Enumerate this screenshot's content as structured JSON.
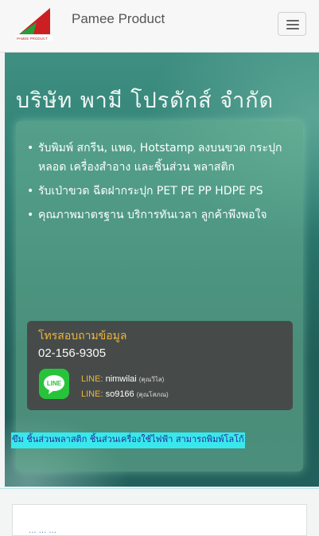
{
  "navbar": {
    "brand": "Pamee Product",
    "logo_text": "PAMEE PRODUCT"
  },
  "hero": {
    "title": "บริษัท พามี โปรดักส์ จำกัด",
    "features": [
      "รับพิมพ์ สกรีน, แพด, Hotstamp ลงบนขวด กระปุก หลอด เครื่องสำอาง และชิ้นส่วน พลาสติก",
      "รับเป่าขวด ฉีดฝากระปุก PET PE PP HDPE PS",
      "คุณภาพมาตรฐาน บริการทันเวลา ลูกค้าพึงพอใจ"
    ],
    "contact": {
      "label": "โทรสอบถามข้อมูล",
      "phone": "02-156-9305",
      "line_icon_text": "LINE",
      "line_entries": [
        {
          "label": "LINE:",
          "id": "nimwilai",
          "note": "(คุณวิไล)"
        },
        {
          "label": "LINE:",
          "id": "so9166",
          "note": "(คุณโสภณ)"
        }
      ]
    },
    "marquee": "ขึม ชิ้นส่วนพลาสติก ชิ้นส่วนเครื่องใช้ไฟฟ้า สามารถพิมพ์โลโก้"
  },
  "card": {
    "text": "... ... ..."
  },
  "colors": {
    "hero_bg": "#2f7e74",
    "contact_bg": "#464646",
    "accent": "#f0b53a",
    "line_green": "#27c43b",
    "marquee_bg": "#39e8ec"
  }
}
